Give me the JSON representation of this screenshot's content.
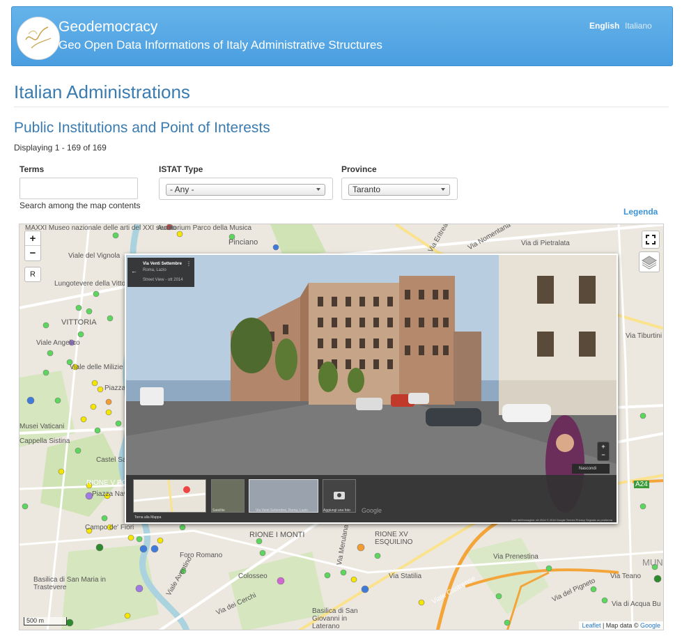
{
  "header": {
    "site_name": "Geodemocracy",
    "slogan": "Geo Open Data Informations of Italy Administrative Structures",
    "languages": [
      "English",
      "Italiano"
    ]
  },
  "page_title": "Italian Administrations",
  "section_title": "Public Institutions and Point of Interests",
  "result_count": "Displaying 1 - 169 of 169",
  "filters": {
    "terms_label": "Terms",
    "terms_value": "",
    "terms_help": "Search among the map contents",
    "istat_label": "ISTAT Type",
    "istat_value": "- Any -",
    "province_label": "Province",
    "province_value": "Taranto"
  },
  "legend_link": "Legenda",
  "map": {
    "zoom_in": "+",
    "zoom_out": "−",
    "reset": "R",
    "scale_label": "500 m",
    "attribution_leaflet": "Leaflet",
    "attribution_sep": " | Map data © ",
    "attribution_google": "Google",
    "labels": [
      "MAXXI Museo nazionale delle arti del XXI secolo",
      "Auditorium Parco della Musica",
      "Pinciano",
      "Viale del Vignola",
      "Lungotevere della Vittoria",
      "VITTORIA",
      "Viale Angelico",
      "Viale delle Milizie",
      "Piazza",
      "Musei Vaticani",
      "Cappella Sistina",
      "Castel Sa",
      "RIONE V PO",
      "Piazza Navo",
      "Campo de' Fiori",
      "Basilica di San Maria in Trastevere",
      "RIONE I MONTI",
      "Foro Romano",
      "Colosseo",
      "Via Merulana",
      "RIONE XV ESQUILINO",
      "Via Statilia",
      "Via Prenestina",
      "Viale Castrense",
      "Basilica di San Giovanni in Laterano",
      "Via dei Cerchi",
      "Via del Pigneto",
      "Via Teano",
      "Via di Acqua Bu",
      "Via di Pietralata",
      "Via Nomentana",
      "Via Tiburtini",
      "Via Eritrea",
      "Viale Aventino",
      "A24",
      "MUN"
    ]
  },
  "street_view": {
    "address": "Via Venti Settembre",
    "locality": "Roma, Lazio",
    "date": "Street View - ott 2014",
    "hide": "Nascondi",
    "back_to_map": "Torna alla Mappa",
    "satellite": "Satellite",
    "thumb_caption": "Via Venti Settembre, Roma, Lazio",
    "add_photo": "Aggiungi una foto",
    "google": "Google",
    "footer": "Dati dell'immagine: ott 2014   © 2016 Google   Termini   Privacy   Segnala un problema"
  },
  "colors": {
    "header": "#4a9ee0",
    "title": "#3a7bb0",
    "link": "#3a93d4",
    "marker_green": "#5cd65c",
    "marker_yellow": "#f5e600",
    "marker_blue": "#3f7bdb"
  },
  "icons": [
    "logo-icon",
    "fullscreen-icon",
    "layers-icon",
    "back-arrow-icon",
    "camera-icon",
    "pin-icon"
  ]
}
